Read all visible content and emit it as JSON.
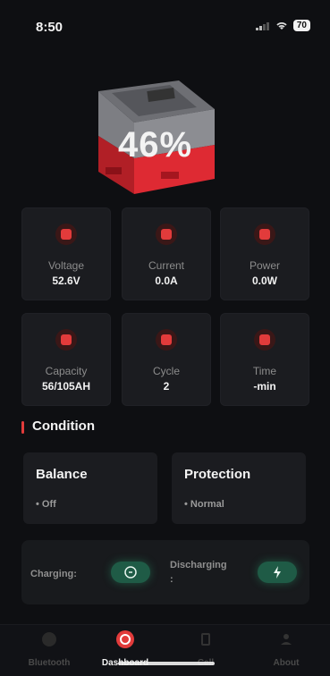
{
  "status": {
    "time": "8:50",
    "battery_level": "70"
  },
  "hero": {
    "percent": "46%"
  },
  "metrics": [
    {
      "label": "Voltage",
      "value": "52.6V",
      "icon": "battery-icon"
    },
    {
      "label": "Current",
      "value": "0.0A",
      "icon": "gauge-icon"
    },
    {
      "label": "Power",
      "value": "0.0W",
      "icon": "meter-icon"
    },
    {
      "label": "Capacity",
      "value": "56/105AH",
      "icon": "battery-pack-icon"
    },
    {
      "label": "Cycle",
      "value": "2",
      "icon": "bar-chart-icon"
    },
    {
      "label": "Time",
      "value": "-min",
      "icon": "clock-icon"
    }
  ],
  "condition": {
    "title": "Condition",
    "balance": {
      "title": "Balance",
      "value": "• Off"
    },
    "protection": {
      "title": "Protection",
      "value": "• Normal"
    }
  },
  "charge": {
    "charging_label": "Charging:",
    "discharging_label": "Discharging",
    "discharging_suffix": ":"
  },
  "tabs": [
    {
      "label": "Bluetooth",
      "icon": "bluetooth-icon"
    },
    {
      "label": "Dashboard",
      "icon": "dashboard-icon"
    },
    {
      "label": "Cell",
      "icon": "cell-icon"
    },
    {
      "label": "About",
      "icon": "user-icon"
    }
  ],
  "colors": {
    "accent": "#e23b3b",
    "toggle_green": "#2dc284",
    "background": "#0e0f12"
  }
}
